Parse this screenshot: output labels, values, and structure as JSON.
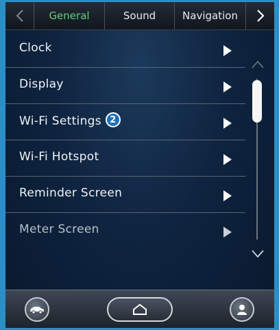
{
  "tabs": {
    "prev_icon": "chevron-left-icon",
    "items": [
      {
        "label": "General",
        "active": true
      },
      {
        "label": "Sound",
        "active": false
      },
      {
        "label": "Navigation",
        "active": false
      }
    ],
    "next_icon": "chevron-right-icon"
  },
  "menu": {
    "items": [
      {
        "label": "Clock"
      },
      {
        "label": "Display"
      },
      {
        "label": "Wi-Fi Settings",
        "badge": "2"
      },
      {
        "label": "Wi-Fi Hotspot"
      },
      {
        "label": "Reminder Screen"
      },
      {
        "label": "Meter Screen"
      }
    ]
  },
  "scrollbar": {
    "up_icon": "chevron-up-icon",
    "down_icon": "chevron-down-icon"
  },
  "bottom_bar": {
    "left_icon": "car-icon",
    "center_icon": "home-icon",
    "right_icon": "user-icon"
  },
  "colors": {
    "active_tab": "#5fd07a",
    "badge": "#1f6fb8",
    "frame": "#2a8fc7"
  }
}
